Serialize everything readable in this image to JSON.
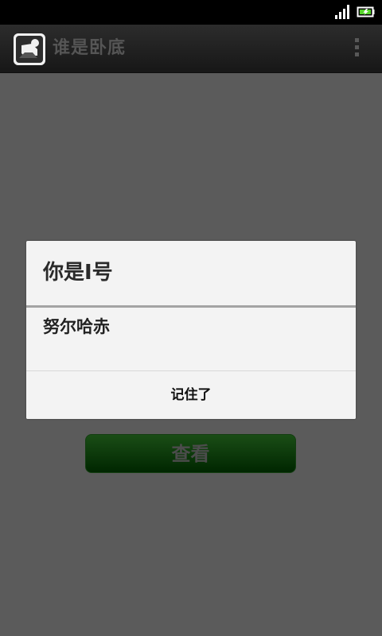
{
  "status_bar": {
    "signal_icon": "signal-strength-icon",
    "battery_icon": "battery-charging-icon"
  },
  "action_bar": {
    "app_icon": "app-logo-icon",
    "title": "谁是卧底",
    "overflow_icon": "overflow-menu-icon"
  },
  "main": {
    "view_button_label": "查看"
  },
  "dialog": {
    "title": "你是I号",
    "message": "努尔哈赤",
    "confirm_label": "记住了"
  }
}
